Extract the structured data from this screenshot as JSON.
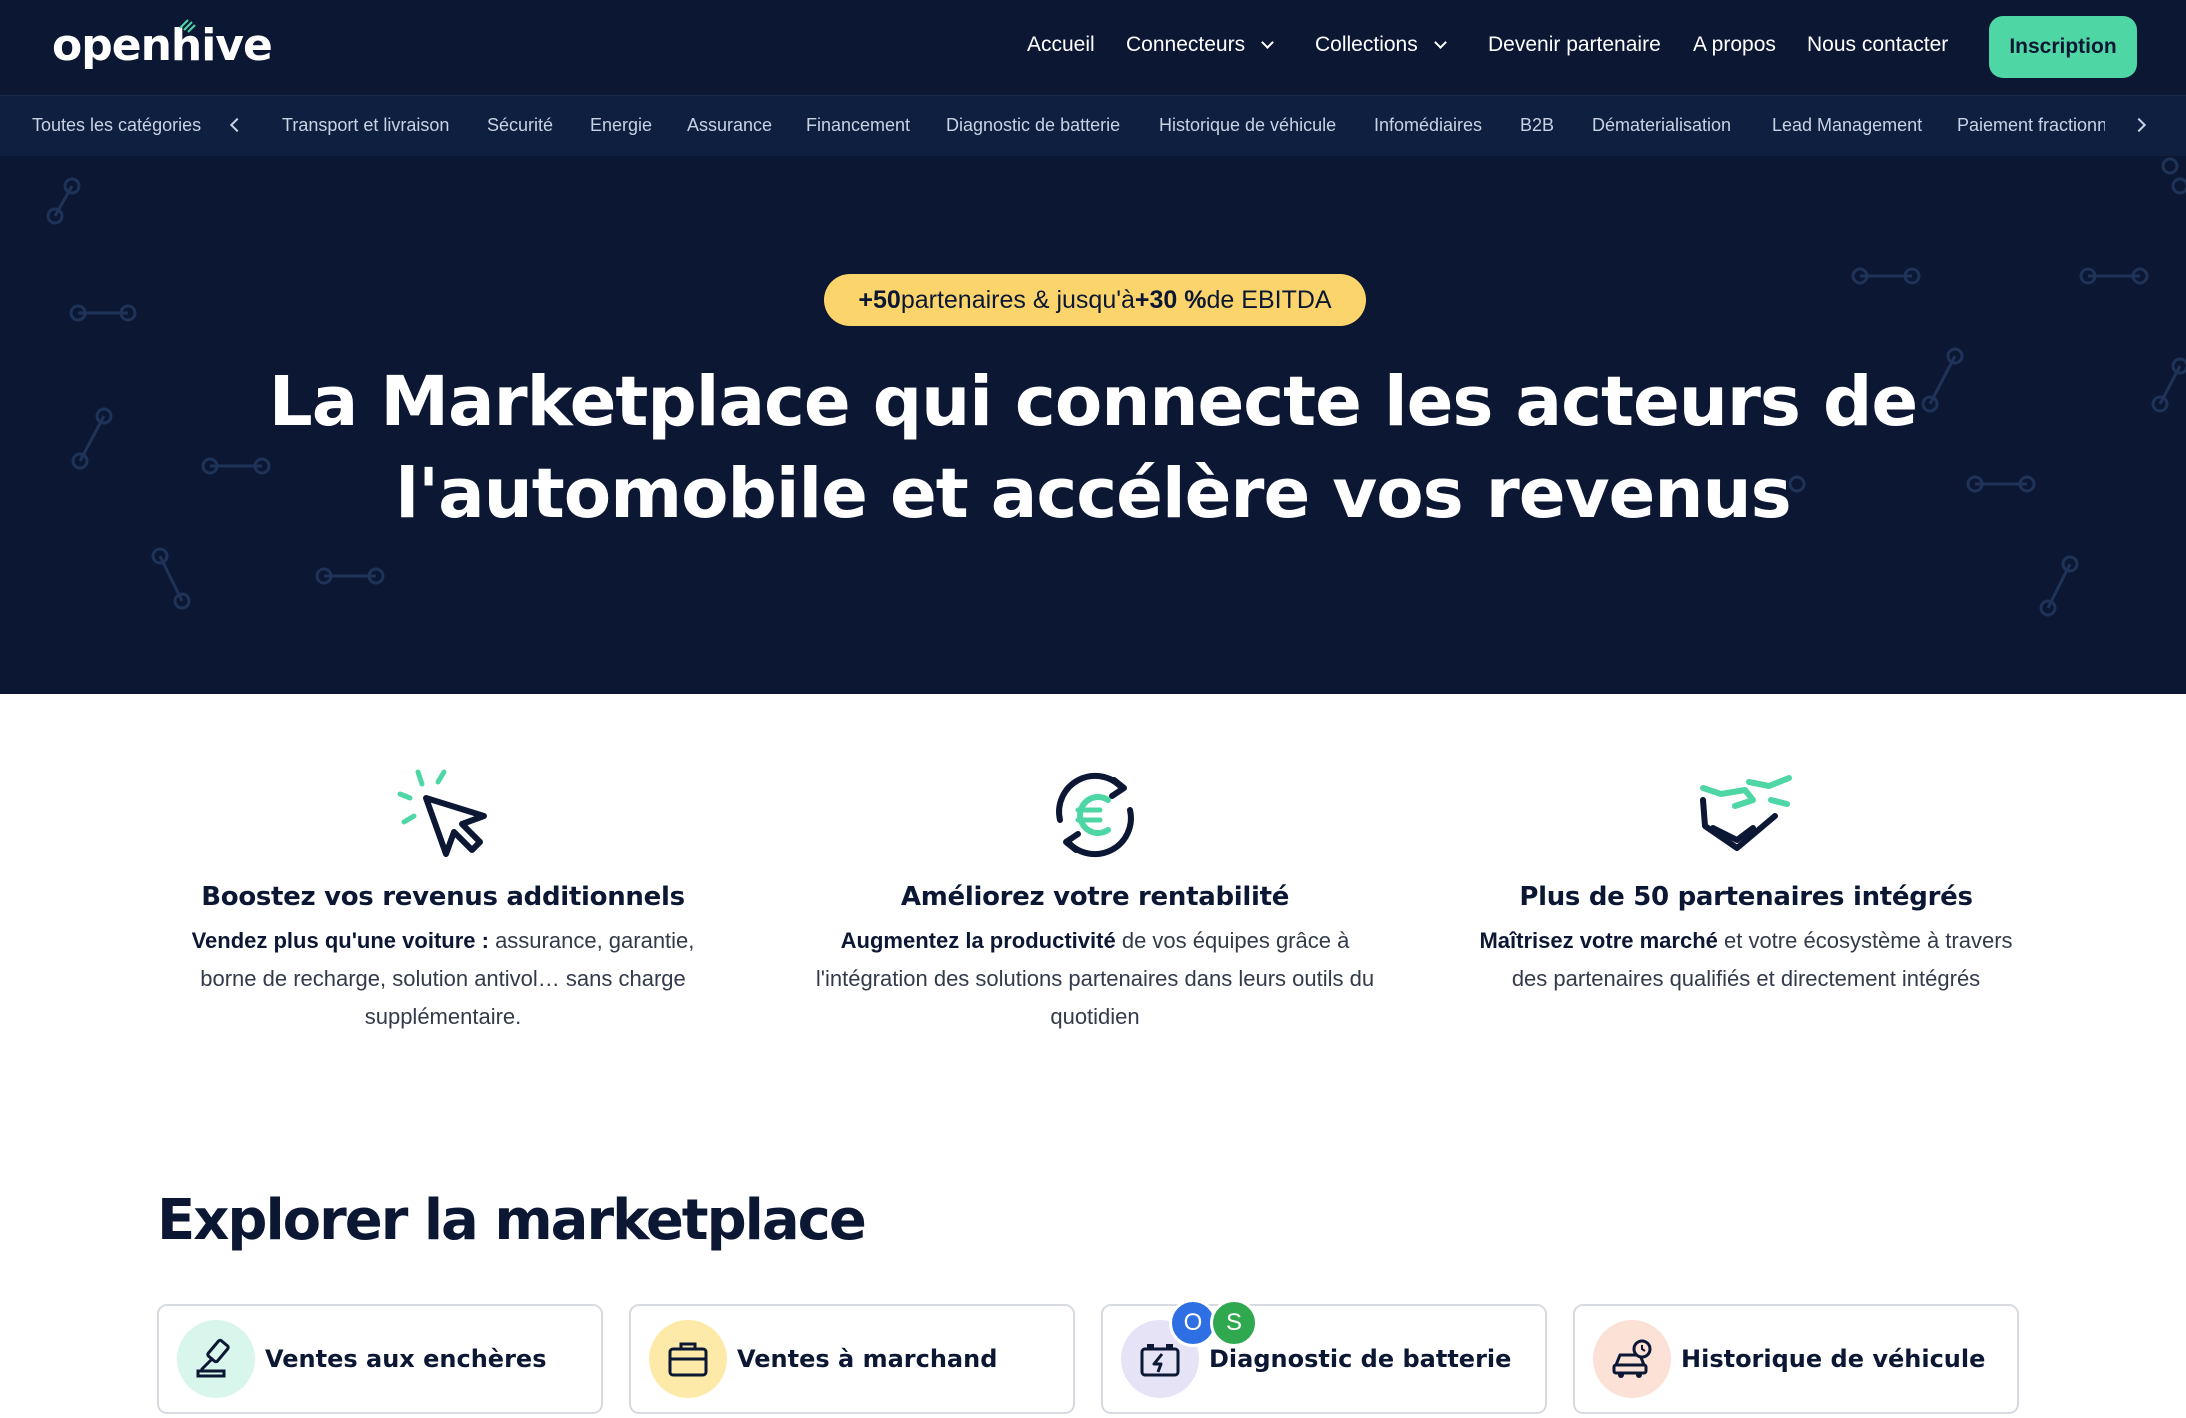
{
  "header": {
    "logo": "openhive",
    "nav": [
      {
        "label": "Accueil"
      },
      {
        "label": "Connecteurs"
      },
      {
        "label": "Collections"
      },
      {
        "label": "Devenir partenaire"
      },
      {
        "label": "A propos"
      },
      {
        "label": "Nous contacter"
      }
    ],
    "cta_label": "Inscription",
    "accent": "#4fd6a5",
    "background": "#0b1733"
  },
  "categories": {
    "all_label": "Toutes les catégories",
    "items": [
      "Transport et livraison",
      "Sécurité",
      "Energie",
      "Assurance",
      "Financement",
      "Diagnostic de batterie",
      "Historique de véhicule",
      "Infomédiaires",
      "B2B",
      "Dématerialisation",
      "Lead Management",
      "Paiement fractionn"
    ]
  },
  "hero": {
    "badge": {
      "part1": "+50",
      "part2": " partenaires & jusqu'à ",
      "part3": "+30 %",
      "part4": " de EBITDA"
    },
    "title_line1": "La Marketplace qui connecte les acteurs de",
    "title_line2": "l'automobile et accélère vos revenus",
    "badge_color": "#fbd56b"
  },
  "features": [
    {
      "icon": "cursor-click-icon",
      "title": "Boostez vos revenus additionnels",
      "lead": "Vendez plus qu'une voiture :",
      "text": " assurance, garantie, borne de recharge, solution antivol… sans charge supplémentaire."
    },
    {
      "icon": "euro-refresh-icon",
      "title": "Améliorez votre rentabilité",
      "lead": "Augmentez la productivité",
      "text": " de vos équipes grâce à l'intégration des solutions partenaires dans leurs outils du quotidien"
    },
    {
      "icon": "handshake-icon",
      "title": "Plus de 50 partenaires intégrés",
      "lead": "Maîtrisez votre marché",
      "text": " et votre écosystème à travers des partenaires qualifiés et directement intégrés"
    }
  ],
  "explore": {
    "title": "Explorer la marketplace",
    "cards": [
      {
        "label": "Ventes aux enchères",
        "icon": "auction-gavel-icon",
        "icon_bg": "#d9f6ec"
      },
      {
        "label": "Ventes à marchand",
        "icon": "briefcase-icon",
        "icon_bg": "#fdeaa9"
      },
      {
        "label": "Diagnostic de batterie",
        "icon": "battery-icon",
        "icon_bg": "#e6e3f7"
      },
      {
        "label": "Historique de véhicule",
        "icon": "car-history-icon",
        "icon_bg": "#fbe1d6"
      }
    ],
    "avatars": [
      {
        "letter": "O",
        "color": "#2f6fe4"
      },
      {
        "letter": "S",
        "color": "#2fa84f"
      }
    ]
  }
}
